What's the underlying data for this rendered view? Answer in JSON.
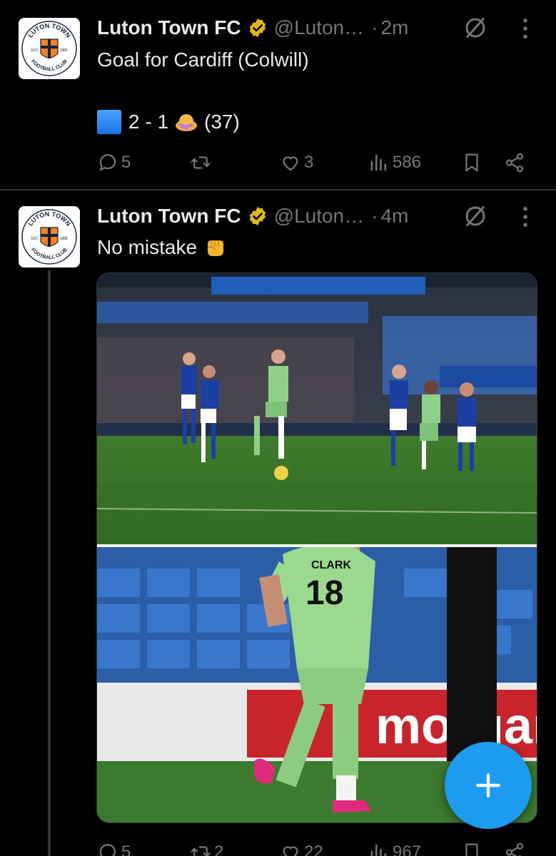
{
  "tweets": [
    {
      "author": "Luton Town FC",
      "handle": "@Luton…",
      "separator": "·",
      "time": "2m",
      "line1": "Goal for Cardiff (Colwill)",
      "score": "2 - 1",
      "minute": "(37)",
      "replies": "5",
      "retweets": "",
      "likes": "3",
      "views": "586"
    },
    {
      "author": "Luton Town FC",
      "handle": "@Luton…",
      "separator": "·",
      "time": "4m",
      "line1": "No mistake",
      "replies": "5",
      "retweets": "2",
      "likes": "22",
      "views": "967"
    }
  ],
  "avatar": {
    "top_text": "LUTON TOWN",
    "bottom_text": "FOOTBALL CLUB",
    "est": "EST.",
    "year": "1885"
  },
  "photo_text": {
    "shirt_name": "CLARK",
    "shirt_number": "18",
    "board_text": "morgan"
  },
  "icons": {
    "verified": "verified-badge-icon",
    "mute": "mute-icon",
    "more": "more-vertical-icon",
    "reply": "reply-icon",
    "retweet": "retweet-icon",
    "like": "heart-icon",
    "views": "views-icon",
    "bookmark": "bookmark-icon",
    "share": "share-icon",
    "compose": "plus-icon"
  },
  "colors": {
    "background": "#000000",
    "text": "#e7e9ea",
    "secondary": "#71767b",
    "accent": "#1d9bf0",
    "verified_gold": "#e2b719",
    "divider": "#2f3336"
  }
}
